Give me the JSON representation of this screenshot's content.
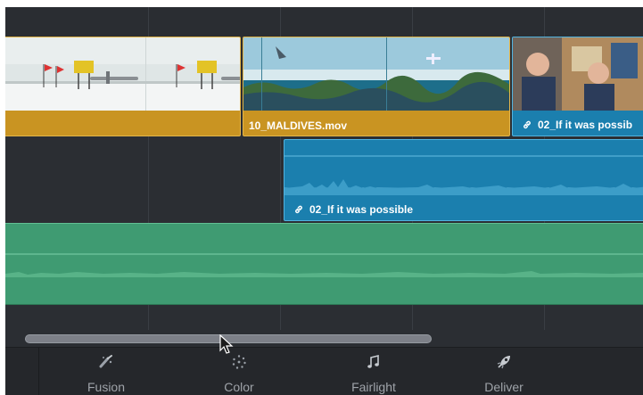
{
  "clips": {
    "video_left": {
      "label": ""
    },
    "video_maldives": {
      "label": "10_MALDIVES.mov"
    },
    "video_interview": {
      "label": "02_If it was possib"
    },
    "audio_blue": {
      "label": "02_If it was possible"
    }
  },
  "page_tabs": [
    {
      "label": "Fusion",
      "icon": "fusion-icon"
    },
    {
      "label": "Color",
      "icon": "color-icon"
    },
    {
      "label": "Fairlight",
      "icon": "fairlight-icon"
    },
    {
      "label": "Deliver",
      "icon": "deliver-icon"
    }
  ],
  "colors": {
    "video_clip": "#c99422",
    "audio_clip_blue": "#1b7fae",
    "audio_track_green": "#3f9b72",
    "timeline_bg": "#2b2e33"
  }
}
